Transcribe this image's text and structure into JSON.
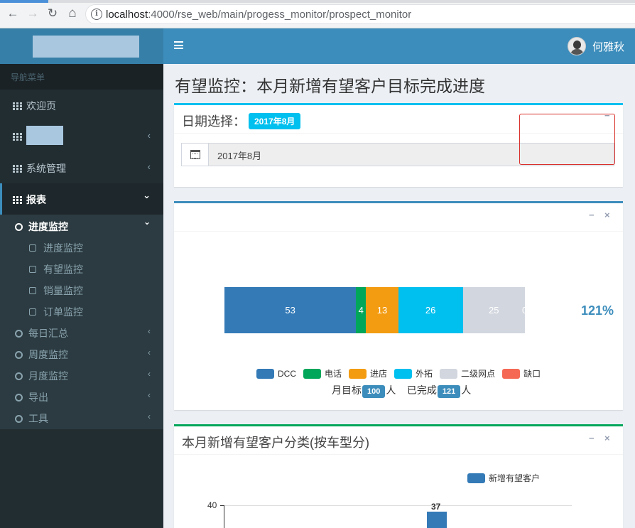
{
  "browser": {
    "url_host": "localhost",
    "url_rest": ":4000/rse_web/main/progess_monitor/prospect_monitor",
    "back_icon": "←",
    "forward_icon": "→",
    "reload_icon": "↻",
    "home_icon": "⌂",
    "info_icon": "i"
  },
  "header": {
    "menu_icon": "bars-icon",
    "user_name": "何雅秋"
  },
  "sidebar": {
    "nav_label": "导航菜单",
    "items": [
      {
        "label": "欢迎页"
      },
      {
        "label": ""
      },
      {
        "label": "系统管理"
      },
      {
        "label": "报表"
      }
    ],
    "report_submenu": {
      "open_label": "进度监控",
      "children": [
        "进度监控",
        "有望监控",
        "销量监控",
        "订单监控"
      ],
      "others": [
        "每日汇总",
        "周度监控",
        "月度监控",
        "导出",
        "工具"
      ]
    },
    "chevron_left": "‹",
    "chevron_down": "⌄"
  },
  "page": {
    "title": "有望监控：本月新增有望客户目标完成进度"
  },
  "date_box": {
    "title": "日期选择：",
    "tag": "2017年8月",
    "input_value": "2017年8月",
    "collapse_icon": "−"
  },
  "progress_box": {
    "collapse_icon": "−",
    "close_icon": "×",
    "percent": "121%",
    "summary_prefix": "月目标",
    "target": "100",
    "summary_mid": "人    已完成",
    "done": "121",
    "summary_suffix": "人"
  },
  "colors": {
    "DCC": "#337ab7",
    "电话": "#00a65a",
    "进店": "#f39c12",
    "外拓": "#00c0ef",
    "二级网点": "#d2d6de",
    "缺口": "#f56954"
  },
  "chart_data": [
    {
      "type": "bar",
      "orientation": "horizontal-stacked",
      "categories": [
        "DCC",
        "电话",
        "进店",
        "外拓",
        "二级网点",
        "缺口"
      ],
      "values": [
        53,
        4,
        13,
        26,
        25,
        0
      ],
      "data_labels": [
        "53",
        "4",
        "13",
        "26",
        "25",
        "0"
      ],
      "legend_position": "bottom"
    },
    {
      "type": "bar",
      "title": "本月新增有望客户分类(按车型分)",
      "series": [
        {
          "name": "新增有望客户",
          "values": [
            37
          ]
        }
      ],
      "y_tick_visible": "40",
      "data_label": "37",
      "legend_position": "top-right"
    }
  ],
  "category_box": {
    "title": "本月新增有望客户分类(按车型分)",
    "collapse_icon": "−",
    "close_icon": "×"
  }
}
